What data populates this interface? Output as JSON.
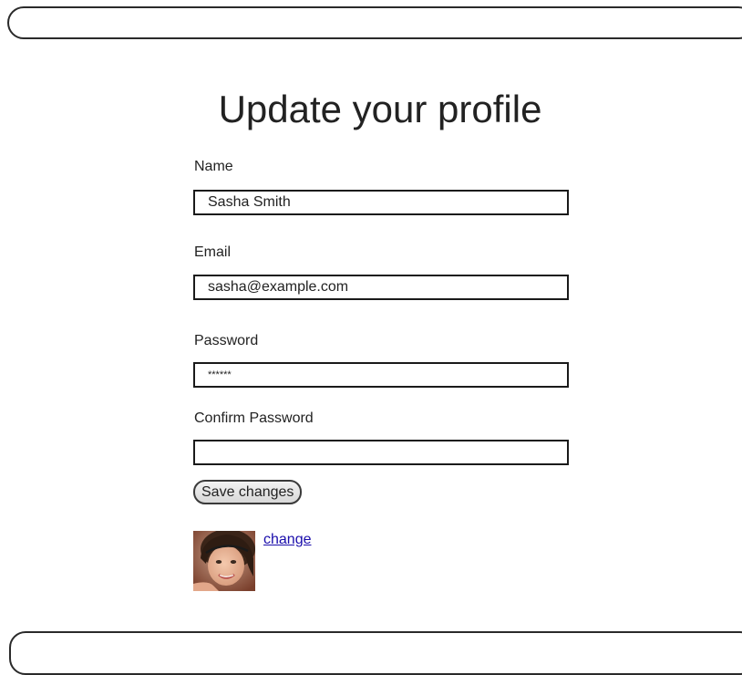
{
  "profile": {
    "title": "Update your profile",
    "name_label": "Name",
    "name_value": "Sasha Smith",
    "email_label": "Email",
    "email_value": "sasha@example.com",
    "password_label": "Password",
    "password_value": "******",
    "confirm_label": "Confirm Password",
    "confirm_value": "",
    "save_label": "Save changes",
    "change_link": "change"
  },
  "colors": {
    "link": "#1a0dab",
    "border": "#1a1a1a",
    "text": "#222222"
  }
}
